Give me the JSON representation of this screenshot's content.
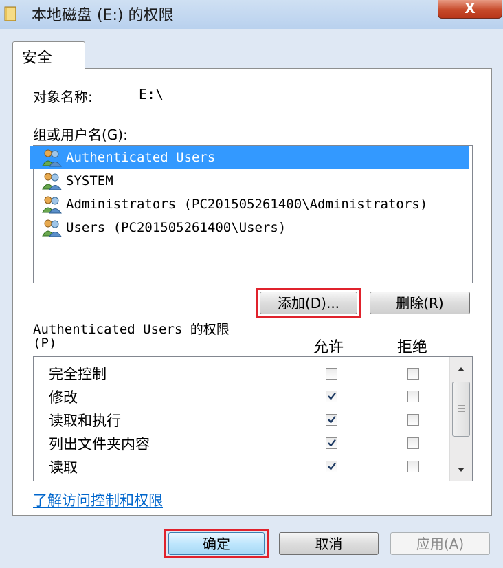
{
  "window": {
    "title": "本地磁盘 (E:) 的权限",
    "close_label": "X"
  },
  "tabs": [
    {
      "label": "安全"
    }
  ],
  "object": {
    "label": "对象名称:",
    "value": "E:\\"
  },
  "users": {
    "label": "组或用户名(G):",
    "items": [
      {
        "name": "Authenticated Users",
        "selected": true
      },
      {
        "name": "SYSTEM",
        "selected": false
      },
      {
        "name": "Administrators (PC201505261400\\Administrators)",
        "selected": false
      },
      {
        "name": "Users (PC201505261400\\Users)",
        "selected": false
      }
    ]
  },
  "buttons": {
    "add": "添加(D)...",
    "remove": "删除(R)",
    "ok": "确定",
    "cancel": "取消",
    "apply": "应用(A)"
  },
  "permissions": {
    "title_line1": "Authenticated Users 的权限",
    "title_line2": "(P)",
    "allow_header": "允许",
    "deny_header": "拒绝",
    "rows": [
      {
        "name": "完全控制",
        "allow": false,
        "deny": false
      },
      {
        "name": "修改",
        "allow": true,
        "deny": false
      },
      {
        "name": "读取和执行",
        "allow": true,
        "deny": false
      },
      {
        "name": "列出文件夹内容",
        "allow": true,
        "deny": false
      },
      {
        "name": "读取",
        "allow": true,
        "deny": false
      }
    ]
  },
  "link": {
    "label": "了解访问控制和权限"
  },
  "colors": {
    "selection": "#3399ff",
    "highlight_border": "#e0222c",
    "link": "#0066cc"
  }
}
